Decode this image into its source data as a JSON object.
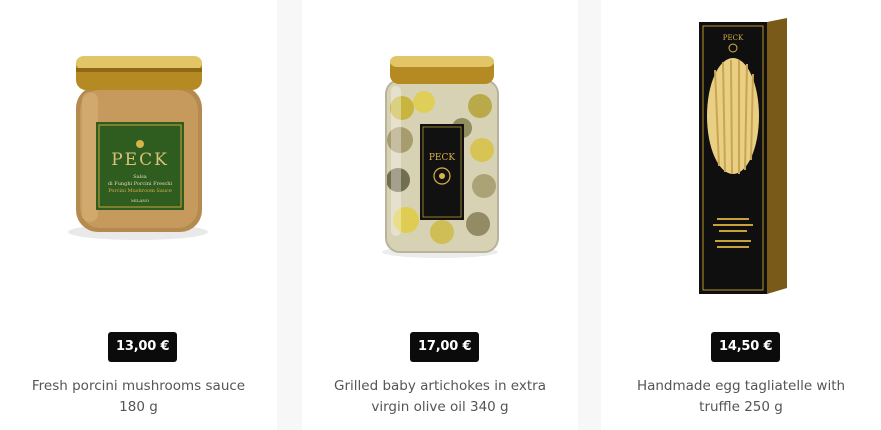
{
  "products": [
    {
      "price": "13,00 €",
      "name_line1": "Fresh porcini mushrooms sauce",
      "name_line2": "180 g",
      "label": {
        "brand": "PECK",
        "line1": "Salsa",
        "line2": "di Funghi Porcini Freschi",
        "line3": "Porcini Mushroom Sauce",
        "city": "MILANO"
      }
    },
    {
      "price": "17,00 €",
      "name_line1": "Grilled baby artichokes in extra",
      "name_line2": "virgin olive oil 340 g",
      "label": {
        "brand": "PECK"
      }
    },
    {
      "price": "14,50 €",
      "name_line1": "Handmade egg tagliatelle with",
      "name_line2": "truffle 250 g",
      "label": {
        "brand": "PECK"
      }
    }
  ],
  "colors": {
    "price_bg": "#0b0b0b",
    "price_text": "#ffffff",
    "name_text": "#555555",
    "gold": "#c9a13a",
    "label_green": "#2f5d1f"
  }
}
